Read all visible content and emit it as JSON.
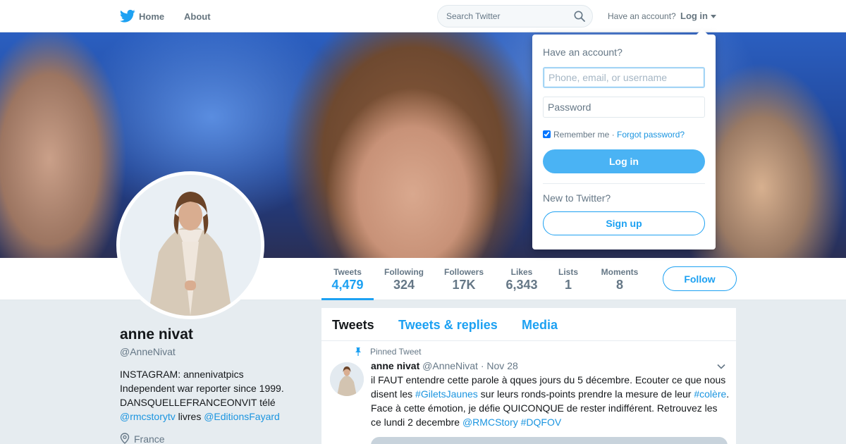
{
  "nav": {
    "home_label": "Home",
    "about_label": "About",
    "search_placeholder": "Search Twitter",
    "have_account": "Have an account?",
    "login_label": "Log in",
    "icons": {
      "logo": "twitter-bird-icon",
      "search": "search-icon",
      "caret": "caret-down-icon"
    }
  },
  "profile": {
    "name": "anne nivat",
    "handle": "@AnneNivat",
    "bio": {
      "line1": "INSTAGRAM: annenivatpics",
      "line2": "Independent war reporter since 1999.",
      "line3": "DANSQUELLEFRANCEONVIT télé",
      "link1": "@rmcstorytv",
      "mid": " livres ",
      "link2": "@EditionsFayard"
    },
    "location": "France"
  },
  "stats": [
    {
      "label": "Tweets",
      "value": "4,479",
      "active": true
    },
    {
      "label": "Following",
      "value": "324"
    },
    {
      "label": "Followers",
      "value": "17K"
    },
    {
      "label": "Likes",
      "value": "6,343"
    },
    {
      "label": "Lists",
      "value": "1"
    },
    {
      "label": "Moments",
      "value": "8"
    }
  ],
  "follow_label": "Follow",
  "timeline": {
    "tabs": [
      "Tweets",
      "Tweets & replies",
      "Media"
    ],
    "active_tab": "Tweets",
    "pinned_label": "Pinned Tweet",
    "tweet": {
      "name": "anne nivat",
      "handle": "@AnneNivat",
      "separator": "·",
      "date": "Nov 28",
      "text_parts": {
        "p1": "il FAUT entendre cette parole à qques jours du 5 décembre. Ecouter ce que nous disent les ",
        "tag1": "#GiletsJaunes",
        "p2": " sur leurs ronds-points prendre la mesure de leur ",
        "tag2": "#colère",
        "p3": ". Face à cette émotion, je défie QUICONQUE de rester indifférent. Retrouvez les ce lundi 2 decembre ",
        "mention": "@RMCStory",
        "p4": " ",
        "tag3": "#DQFOV"
      }
    }
  },
  "login_dropdown": {
    "title": "Have an account?",
    "username_placeholder": "Phone, email, or username",
    "password_placeholder": "Password",
    "remember_label": "Remember me",
    "remember_checked": true,
    "separator": " · ",
    "forgot_label": "Forgot password?",
    "login_button": "Log in",
    "new_label": "New to Twitter?",
    "signup_button": "Sign up"
  },
  "colors": {
    "accent": "#1da1f2",
    "link": "#1b95e0",
    "page_background": "#e6ecf0",
    "login_button": "#4ab3f4",
    "muted_text": "#657786"
  }
}
